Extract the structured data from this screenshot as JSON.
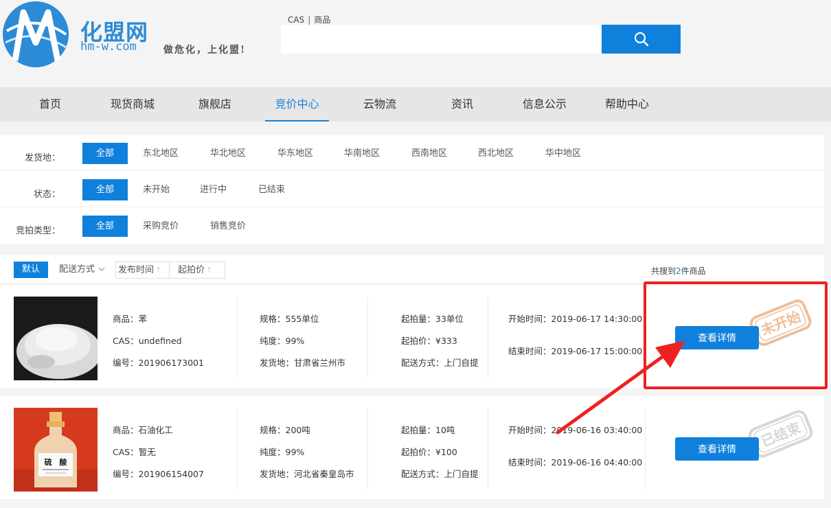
{
  "header": {
    "brand_title": "化盟网",
    "brand_domain": "hm-w.com",
    "brand_slogan": "做危化，上化盟!",
    "search_tab_cas": "CAS",
    "search_tab_sep": "|",
    "search_tab_goods": "商品",
    "search_placeholder": ""
  },
  "nav": {
    "items": [
      {
        "label": "首页"
      },
      {
        "label": "现货商城"
      },
      {
        "label": "旗舰店"
      },
      {
        "label": "竞价中心"
      },
      {
        "label": "云物流"
      },
      {
        "label": "资讯"
      },
      {
        "label": "信息公示"
      },
      {
        "label": "帮助中心"
      }
    ],
    "active_index": 3
  },
  "filters": {
    "ship_from": {
      "label": "发货地：",
      "options": [
        "全部",
        "东北地区",
        "华北地区",
        "华东地区",
        "华南地区",
        "西南地区",
        "西北地区",
        "华中地区"
      ]
    },
    "status": {
      "label": "状态：",
      "options": [
        "全部",
        "未开始",
        "进行中",
        "已结束"
      ]
    },
    "bid_type": {
      "label": "竞拍类型：",
      "options": [
        "全部",
        "采购竞价",
        "销售竞价"
      ]
    }
  },
  "sortbar": {
    "default_label": "默认",
    "delivery_label": "配送方式",
    "time_label": "发布时间",
    "price_label": "起拍价",
    "result_prefix": "共搜到",
    "result_count": "2",
    "result_suffix": "件商品"
  },
  "listings": [
    {
      "product": "商品：苯",
      "cas": "CAS：undefined",
      "code": "编号：201906173001",
      "spec": "规格：555单位",
      "purity": "纯度：99%",
      "ship_from": "发货地：甘肃省兰州市",
      "min_qty": "起拍量：33单位",
      "start_price": "起拍价：¥333",
      "delivery": "配送方式：上门自提",
      "start_time": "开始时间：2019-06-17 14:30:00",
      "end_time": "结束时间：2019-06-17 15:00:00",
      "button": "查看详情",
      "stamp": "未开始",
      "stamp_color": "#e8a97a"
    },
    {
      "product": "商品：石油化工",
      "cas": "CAS：暂无",
      "code": "编号：201906154007",
      "spec": "规格：200吨",
      "purity": "纯度：99%",
      "ship_from": "发货地：河北省秦皇岛市",
      "min_qty": "起拍量：10吨",
      "start_price": "起拍价：¥100",
      "delivery": "配送方式：上门自提",
      "start_time": "开始时间：2019-06-16 03:40:00",
      "end_time": "结束时间：2019-06-16 04:40:00",
      "button": "查看详情",
      "stamp": "已结束",
      "stamp_color": "#cfcfcf",
      "bottle_label": "硫　酸"
    }
  ],
  "colors": {
    "primary": "#0f80dc",
    "annotation": "#ef2020"
  }
}
